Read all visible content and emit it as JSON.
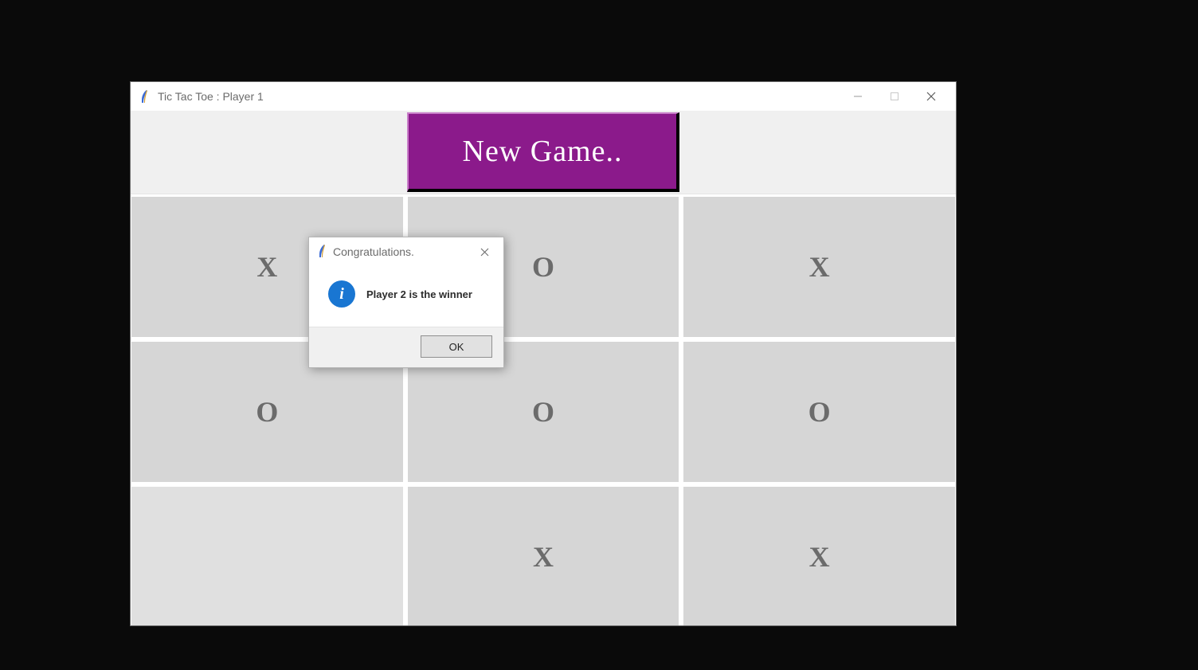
{
  "window": {
    "title": "Tic Tac Toe : Player 1"
  },
  "header": {
    "new_game_label": "New Game.."
  },
  "board": {
    "cells": [
      "X",
      "O",
      "X",
      "O",
      "O",
      "O",
      "",
      "X",
      "X"
    ]
  },
  "dialog": {
    "title": "Congratulations.",
    "message": "Player 2 is the winner",
    "ok_label": "OK",
    "info_glyph": "i"
  }
}
